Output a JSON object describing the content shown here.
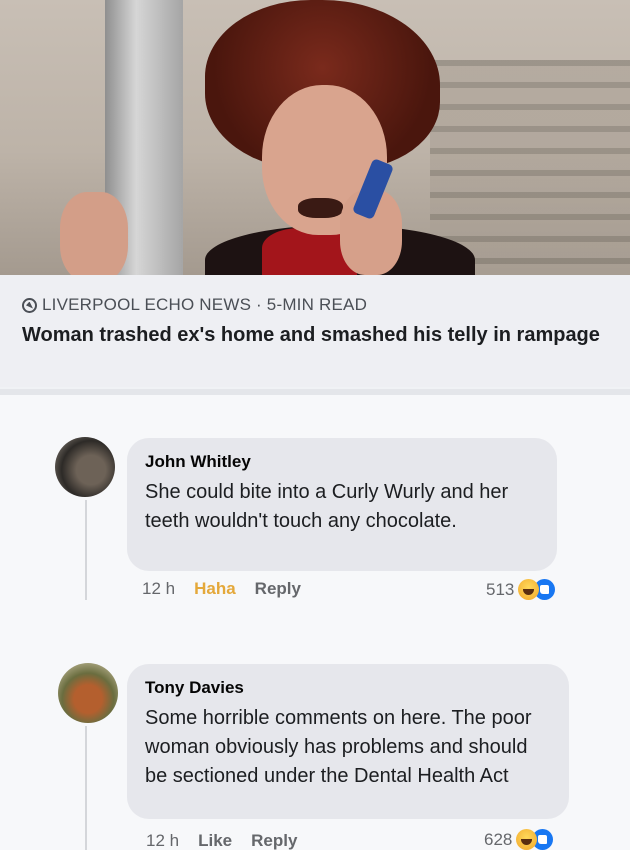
{
  "article": {
    "source": "LIVERPOOL ECHO NEWS · 5-MIN READ",
    "headline": "Woman trashed ex's home and smashed his telly in rampage"
  },
  "comments": [
    {
      "author": "John Whitley",
      "text": "She could bite into a Curly Wurly and her teeth wouldn't touch any chocolate.",
      "time": "12 h",
      "reaction_label": "Haha",
      "reply_label": "Reply",
      "reaction_count": "513",
      "reaction_icons": [
        "haha-emoji",
        "like-emoji"
      ]
    },
    {
      "author": "Tony Davies",
      "text": "Some horrible comments on here. The poor woman obviously has problems and should be sectioned under the Dental Health Act",
      "time": "12 h",
      "reaction_label": "Like",
      "reply_label": "Reply",
      "reaction_count": "628",
      "reaction_icons": [
        "haha-emoji",
        "like-emoji"
      ]
    }
  ],
  "colors": {
    "haha_active": "#e4a83a",
    "link_blue": "#1877f2",
    "bubble_bg": "#e6e7ec"
  }
}
